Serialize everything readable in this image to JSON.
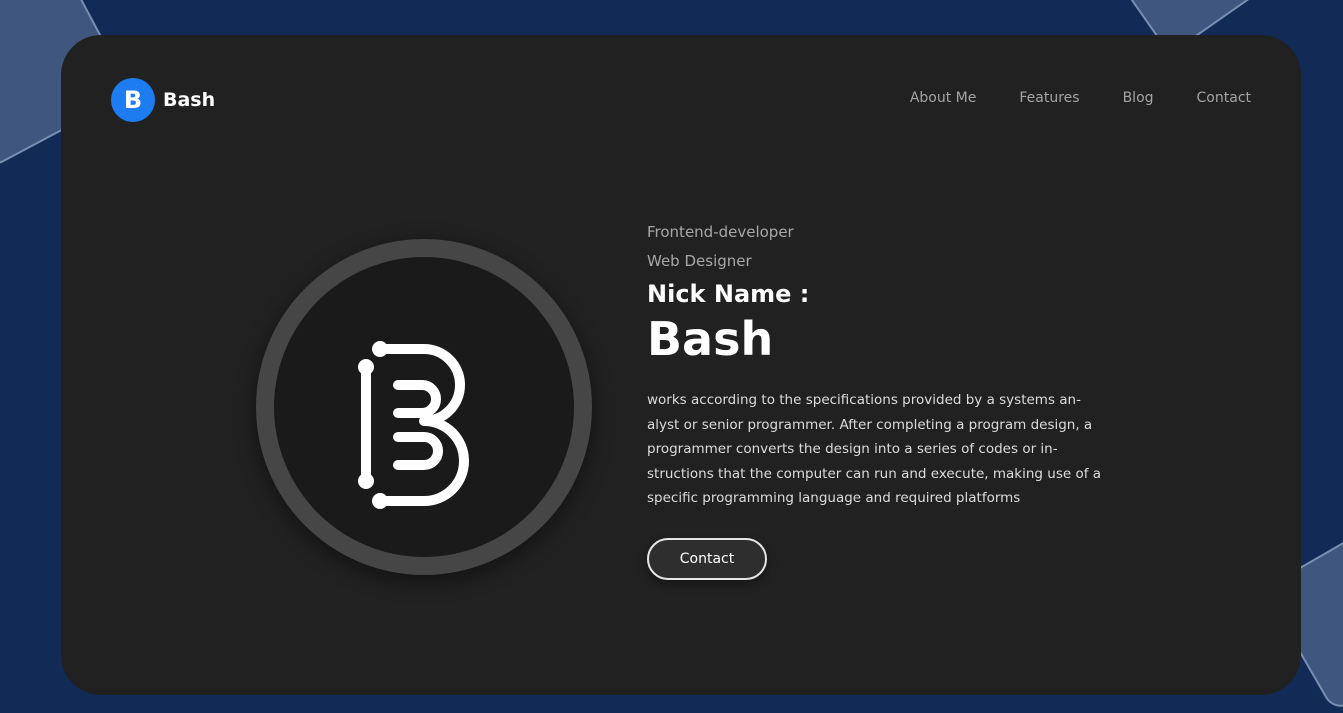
{
  "brand": {
    "badge_letter": "B",
    "name": "Bash",
    "accent_color": "#1e7cf2"
  },
  "nav": {
    "items": [
      "About Me",
      "Features",
      "Blog",
      "Contact"
    ]
  },
  "hero": {
    "role_1": "Frontend-developer",
    "role_2": "Web Designer",
    "nickname_label": "Nick Name :",
    "nickname": "Bash",
    "description": "works according to the specifications provided by a systems an-alyst or senior programmer. After completing a program design, a programmer converts the design into a series of codes or in-structions that the computer can run and execute, making use of a specific programming language and required platforms",
    "cta_label": "Contact"
  },
  "avatar": {
    "icon": "b-logo-icon"
  },
  "colors": {
    "page_background": "#122a56",
    "card_background": "#212121"
  }
}
